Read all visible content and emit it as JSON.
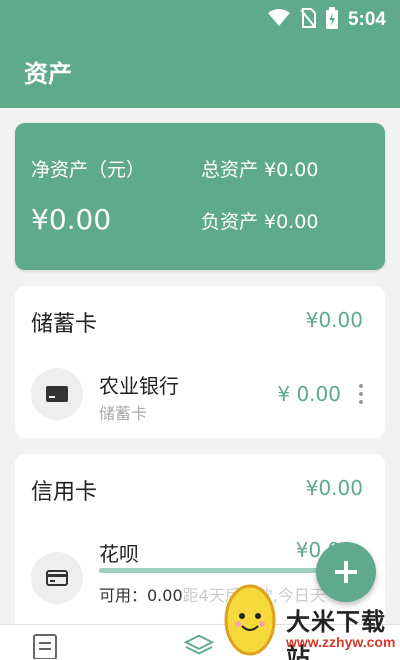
{
  "status_bar": {
    "time": "5:04"
  },
  "app_bar": {
    "title": "资产"
  },
  "summary": {
    "net_label": "净资产（元）",
    "net_value": "¥0.00",
    "total_label": "总资产 ¥0.00",
    "debt_label": "负资产 ¥0.00"
  },
  "debit_section": {
    "title": "储蓄卡",
    "total": "¥0.00",
    "accounts": [
      {
        "name": "农业银行",
        "type": "储蓄卡",
        "balance": "¥ 0.00"
      }
    ]
  },
  "credit_section": {
    "title": "信用卡",
    "total": "¥0.00",
    "accounts": [
      {
        "name": "花呗",
        "balance": "¥0.00",
        "available": "可用：0.00",
        "due": "距4天后还款,今日天",
        "credit_used_fraction": 1.0
      }
    ]
  },
  "watermark": {
    "title": "大米下载站",
    "url": "www.zzhyw.com"
  },
  "colors": {
    "primary": "#5fa98d",
    "card": "#ffffff",
    "background": "#f2f2f2"
  },
  "icons": [
    "wifi-icon",
    "no-sim-icon",
    "battery-charging-icon",
    "card-icon",
    "credit-card-icon",
    "plus-icon",
    "list-icon",
    "layers-icon"
  ]
}
